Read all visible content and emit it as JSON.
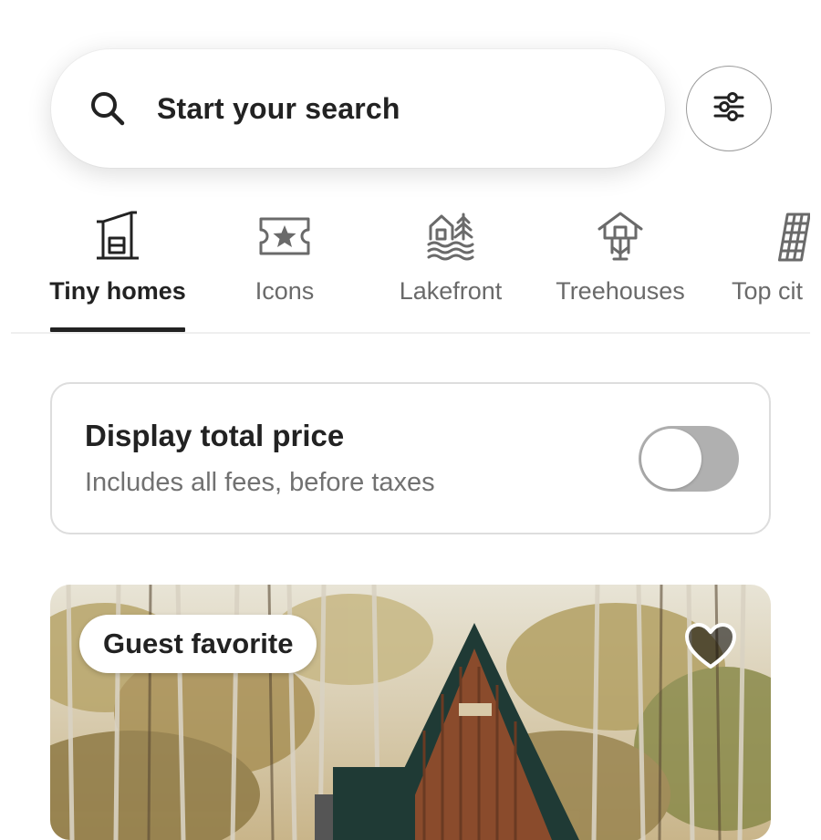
{
  "search": {
    "placeholder": "Start your search",
    "search_icon": "search-icon",
    "filter_icon": "sliders-icon"
  },
  "categories": [
    {
      "label": "Tiny homes",
      "icon": "tiny-home-icon",
      "active": true
    },
    {
      "label": "Icons",
      "icon": "ticket-star-icon",
      "active": false
    },
    {
      "label": "Lakefront",
      "icon": "lakefront-icon",
      "active": false
    },
    {
      "label": "Treehouses",
      "icon": "treehouse-icon",
      "active": false
    },
    {
      "label": "Top cit",
      "icon": "leaning-tower-icon",
      "active": false
    }
  ],
  "price_toggle": {
    "title": "Display total price",
    "subtitle": "Includes all fees, before taxes",
    "enabled": false
  },
  "listing": {
    "badge": "Guest favorite",
    "favorite_icon": "heart-icon",
    "favorited": false
  },
  "colors": {
    "text_primary": "#222222",
    "text_secondary": "#717171",
    "toggle_off": "#b0b0b0",
    "border": "#dddddd"
  }
}
